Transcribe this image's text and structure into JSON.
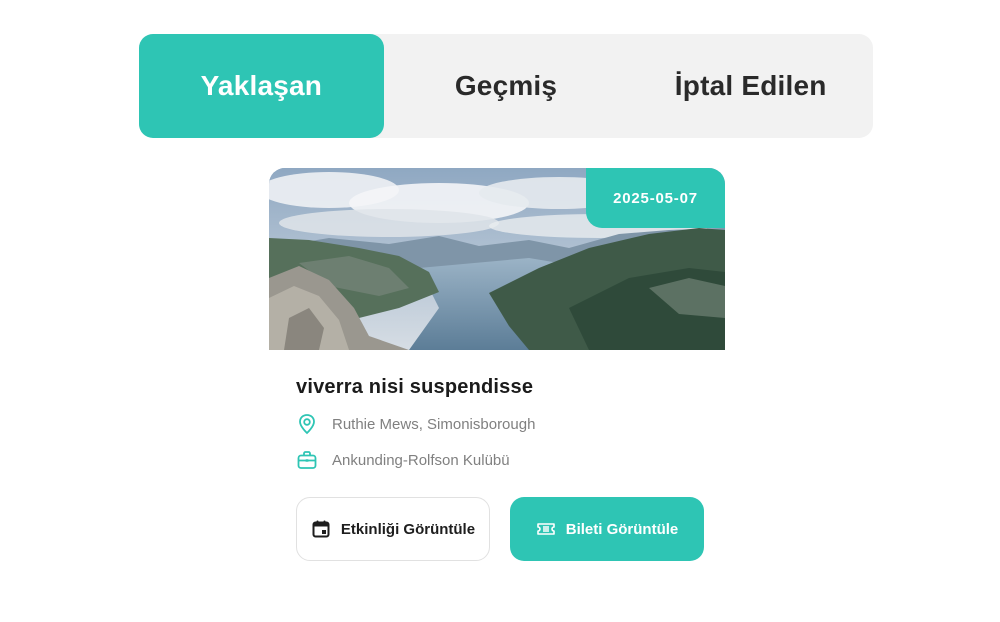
{
  "tabs": [
    {
      "label": "Yaklaşan",
      "active": true
    },
    {
      "label": "Geçmiş",
      "active": false
    },
    {
      "label": "İptal Edilen",
      "active": false
    }
  ],
  "event": {
    "date": "2025-05-07",
    "title": "viverra nisi suspendisse",
    "location": "Ruthie Mews, Simonisborough",
    "club": "Ankunding-Rolfson Kulübü",
    "image_icon": "fjord-landscape-photo"
  },
  "actions": {
    "view_event_label": "Etkinliği Görüntüle",
    "view_event_icon": "calendar-icon",
    "view_ticket_label": "Bileti Görüntüle",
    "view_ticket_icon": "ticket-icon"
  },
  "colors": {
    "accent": "#2ec5b4",
    "tab_bar_bg": "#f2f2f2",
    "meta_text": "#808080"
  }
}
